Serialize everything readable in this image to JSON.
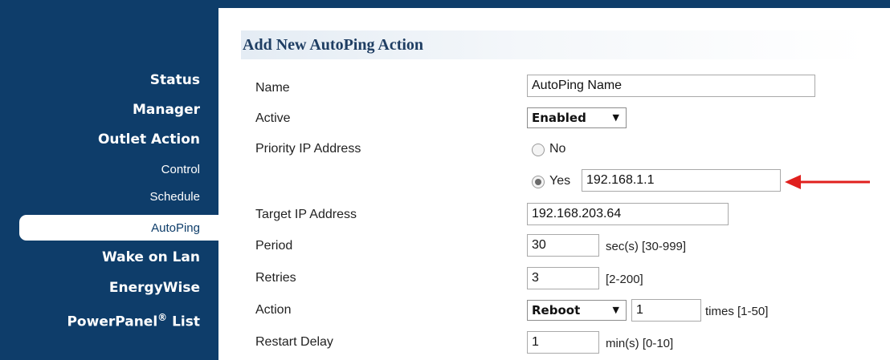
{
  "nav": {
    "items": [
      {
        "label": "Status",
        "kind": "main"
      },
      {
        "label": "Manager",
        "kind": "main"
      },
      {
        "label": "Outlet Action",
        "kind": "main"
      },
      {
        "label": "Control",
        "kind": "sub"
      },
      {
        "label": "Schedule",
        "kind": "sub"
      },
      {
        "label": "AutoPing",
        "kind": "sub",
        "active": true
      },
      {
        "label": "Wake on Lan",
        "kind": "main"
      },
      {
        "label": "EnergyWise",
        "kind": "main"
      },
      {
        "label": "PowerPanel",
        "sup": "®",
        "suffix": " List",
        "kind": "main"
      }
    ]
  },
  "form": {
    "title": "Add New AutoPing Action",
    "name": {
      "label": "Name",
      "value": "AutoPing Name"
    },
    "active": {
      "label": "Active",
      "selected": "Enabled"
    },
    "priority": {
      "label": "Priority IP Address",
      "no_label": "No",
      "yes_label": "Yes",
      "selected": "Yes",
      "ip_value": "192.168.1.1"
    },
    "target": {
      "label": "Target IP Address",
      "value": "192.168.203.64"
    },
    "period": {
      "label": "Period",
      "value": "30",
      "hint": "sec(s) [30-999]"
    },
    "retries": {
      "label": "Retries",
      "value": "3",
      "hint": "[2-200]"
    },
    "action": {
      "label": "Action",
      "selected": "Reboot",
      "times_value": "1",
      "hint": "times [1-50]"
    },
    "restart_delay": {
      "label": "Restart Delay",
      "value": "1",
      "hint": "min(s) [0-10]"
    }
  },
  "annotation": {
    "arrow_color": "#e0201e",
    "icon": "red-arrow-left"
  },
  "colors": {
    "nav_bg": "#0e3d6a",
    "title": "#1f3e63"
  },
  "icons": {
    "dropdown": "triangle-down-icon",
    "radio": "radio-button-icon"
  }
}
